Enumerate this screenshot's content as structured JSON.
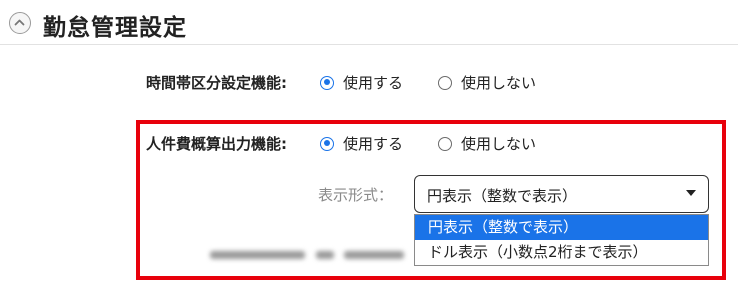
{
  "section": {
    "title": "勤怠管理設定"
  },
  "time_zone_setting": {
    "label": "時間帯区分設定機能:",
    "options": [
      {
        "label": "使用する",
        "checked": true
      },
      {
        "label": "使用しない",
        "checked": false
      }
    ]
  },
  "labor_cost_setting": {
    "label": "人件費概算出力機能:",
    "options": [
      {
        "label": "使用する",
        "checked": true
      },
      {
        "label": "使用しない",
        "checked": false
      }
    ],
    "display_format": {
      "label": "表示形式：",
      "selected_value": "円表示（整数で表示）",
      "options": [
        {
          "label": "円表示（整数で表示）",
          "selected": true
        },
        {
          "label": "ドル表示（小数点2桁まで表示）",
          "selected": false
        }
      ]
    }
  },
  "colors": {
    "accent": "#1a73e8",
    "highlight_border": "#e8000b"
  },
  "icons": {
    "collapse": "chevron-up-icon",
    "caret": "caret-down-icon"
  }
}
